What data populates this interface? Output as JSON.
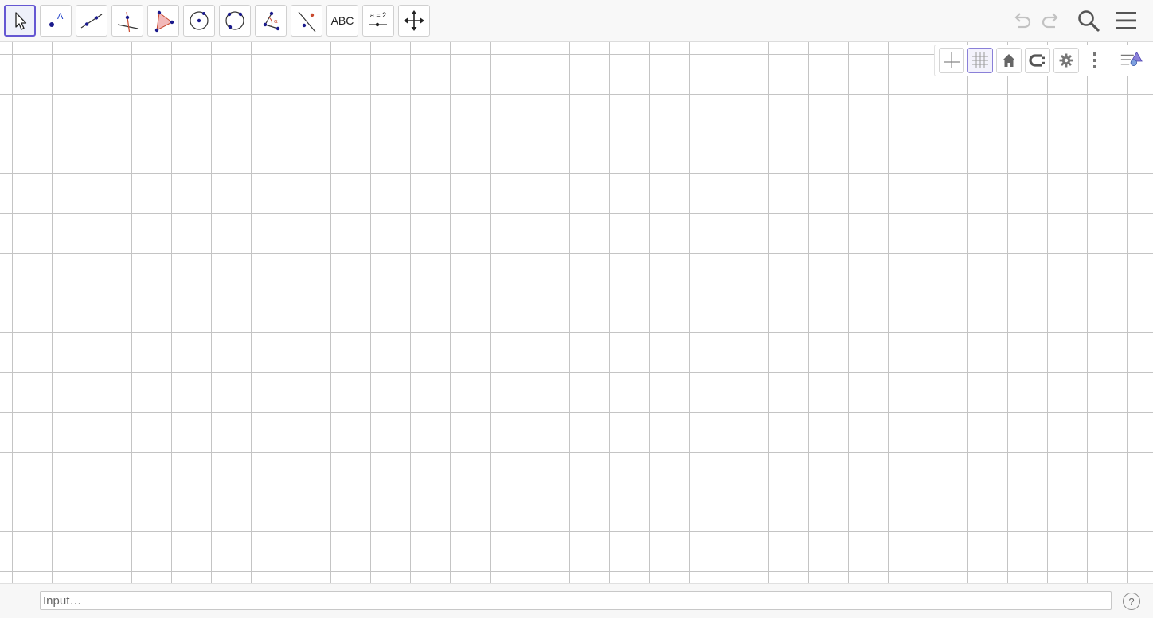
{
  "toolbar": {
    "tools": [
      {
        "name": "move-tool",
        "icon": "arrow-cursor-icon"
      },
      {
        "name": "point-tool",
        "icon": "point-icon",
        "label": "A"
      },
      {
        "name": "line-tool",
        "icon": "line-icon"
      },
      {
        "name": "perpendicular-line-tool",
        "icon": "perpendicular-icon"
      },
      {
        "name": "polygon-tool",
        "icon": "polygon-icon"
      },
      {
        "name": "circle-center-point-tool",
        "icon": "circle-center-icon"
      },
      {
        "name": "circle-three-points-tool",
        "icon": "circle-three-points-icon"
      },
      {
        "name": "angle-tool",
        "icon": "angle-icon",
        "label": "α"
      },
      {
        "name": "reflect-tool",
        "icon": "reflect-icon"
      },
      {
        "name": "text-tool",
        "icon": "text-icon",
        "label": "ABC"
      },
      {
        "name": "slider-tool",
        "icon": "slider-icon",
        "label": "a = 2"
      },
      {
        "name": "move-graphics-view-tool",
        "icon": "move-view-icon"
      }
    ],
    "undo_icon": "undo-icon",
    "redo_icon": "redo-icon",
    "search_icon": "search-icon",
    "menu_icon": "hamburger-menu-icon"
  },
  "style_bar": {
    "buttons": [
      "axes-toggle-icon",
      "grid-toggle-icon",
      "home-icon",
      "point-capturing-icon",
      "gear-icon",
      "more-icon",
      "style-bar-toggle-icon"
    ]
  },
  "input_bar": {
    "placeholder": "Input…",
    "value": "",
    "help_label": "?"
  },
  "colors": {
    "accent": "#6557d2",
    "point": "#1a1a8c",
    "grid": "#c4c4c4",
    "polygon_fill": "#f2b8b8",
    "angle": "#c94a2f"
  }
}
